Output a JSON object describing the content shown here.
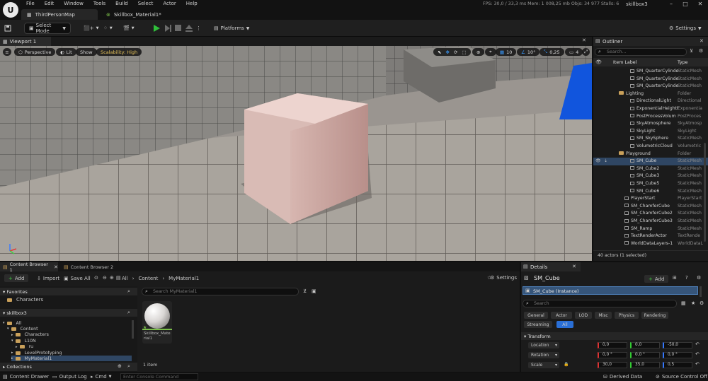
{
  "titlebar": {
    "logo": "U",
    "menu": [
      "File",
      "Edit",
      "Window",
      "Tools",
      "Build",
      "Select",
      "Actor",
      "Help"
    ],
    "tabs": [
      {
        "label": "ThirdPersonMap"
      },
      {
        "label": "Skillbox_Material1*"
      }
    ],
    "stats": "FPS: 30,0 / 33,3 ms  Mem: 1 008,25 mb  Objs: 34 977  Stalls: 6",
    "project": "skillbox3",
    "colors": {
      "bg": "#121212",
      "accent": "#0070e0"
    }
  },
  "toolbar": {
    "select_mode": "Select Mode",
    "platforms": "Platforms",
    "settings": "Settings"
  },
  "viewport": {
    "tab_label": "Viewport 1",
    "perspective": "Perspective",
    "lit": "Lit",
    "show": "Show",
    "scalability": "Scalability: High",
    "grid_snap": "10",
    "rot_snap": "10°",
    "scale_snap": "0,25",
    "cam_speed": "4"
  },
  "outliner": {
    "title": "Outliner",
    "search_placeholder": "Search...",
    "col_label": "Item Label",
    "col_type": "Type",
    "rows": [
      {
        "label": "SM_QuarterCylinde",
        "type": "StaticMesh",
        "indent": 2,
        "kind": "mesh"
      },
      {
        "label": "SM_QuarterCylinde",
        "type": "StaticMesh",
        "indent": 2,
        "kind": "mesh"
      },
      {
        "label": "SM_QuarterCylinde",
        "type": "StaticMesh",
        "indent": 2,
        "kind": "mesh"
      },
      {
        "label": "Lighting",
        "type": "Folder",
        "indent": 1,
        "kind": "folder"
      },
      {
        "label": "DirectionalLight",
        "type": "Directional",
        "indent": 2,
        "kind": "mesh"
      },
      {
        "label": "ExponentialHeightF",
        "type": "Exponentia",
        "indent": 2,
        "kind": "mesh"
      },
      {
        "label": "PostProcessVolum",
        "type": "PostProces",
        "indent": 2,
        "kind": "mesh"
      },
      {
        "label": "SkyAtmosphere",
        "type": "SkyAtmosp",
        "indent": 2,
        "kind": "mesh"
      },
      {
        "label": "SkyLight",
        "type": "SkyLight",
        "indent": 2,
        "kind": "mesh"
      },
      {
        "label": "SM_SkySphere",
        "type": "StaticMesh",
        "indent": 2,
        "kind": "mesh"
      },
      {
        "label": "VolumetricCloud",
        "type": "Volumetric",
        "indent": 2,
        "kind": "mesh"
      },
      {
        "label": "Playground",
        "type": "Folder",
        "indent": 1,
        "kind": "folder"
      },
      {
        "label": "SM_Cube",
        "type": "StaticMesh",
        "indent": 2,
        "kind": "mesh",
        "selected": true
      },
      {
        "label": "SM_Cube2",
        "type": "StaticMesh",
        "indent": 2,
        "kind": "mesh"
      },
      {
        "label": "SM_Cube3",
        "type": "StaticMesh",
        "indent": 2,
        "kind": "mesh"
      },
      {
        "label": "SM_Cube5",
        "type": "StaticMesh",
        "indent": 2,
        "kind": "mesh"
      },
      {
        "label": "SM_Cube6",
        "type": "StaticMesh",
        "indent": 2,
        "kind": "mesh"
      },
      {
        "label": "PlayerStart",
        "type": "PlayerStart",
        "indent": 1,
        "kind": "mesh"
      },
      {
        "label": "SM_ChamferCube",
        "type": "StaticMesh",
        "indent": 1,
        "kind": "mesh"
      },
      {
        "label": "SM_ChamferCube2",
        "type": "StaticMesh",
        "indent": 1,
        "kind": "mesh"
      },
      {
        "label": "SM_ChamferCube3",
        "type": "StaticMesh",
        "indent": 1,
        "kind": "mesh"
      },
      {
        "label": "SM_Ramp",
        "type": "StaticMesh",
        "indent": 1,
        "kind": "mesh"
      },
      {
        "label": "TextRenderActor",
        "type": "TextRende",
        "indent": 1,
        "kind": "mesh"
      },
      {
        "label": "WorldDataLayers-1",
        "type": "WorldDataL",
        "indent": 1,
        "kind": "mesh"
      }
    ],
    "footer": "40 actors (1 selected)"
  },
  "content_browser": {
    "tabs": [
      "Content Browser 1",
      "Content Browser 2"
    ],
    "add": "Add",
    "import": "Import",
    "save_all": "Save All",
    "breadcrumb": [
      "All",
      "Content",
      "MyMaterial1"
    ],
    "settings": "Settings",
    "favorites": "Favorites",
    "favorites_items": [
      "Characters"
    ],
    "project": "skillbox3",
    "tree": [
      {
        "label": "All",
        "indent": 0
      },
      {
        "label": "Content",
        "indent": 1
      },
      {
        "label": "Characters",
        "indent": 2
      },
      {
        "label": "L10N",
        "indent": 2
      },
      {
        "label": "ru",
        "indent": 3
      },
      {
        "label": "LevelPrototyping",
        "indent": 2
      },
      {
        "label": "MyMaterial1",
        "indent": 2,
        "selected": true
      }
    ],
    "collections": "Collections",
    "search_placeholder": "Search MyMaterial1",
    "asset_name": "Skillbox_Material1",
    "item_count": "1 item"
  },
  "details": {
    "title": "Details",
    "object": "SM_Cube",
    "add": "Add",
    "instance": "SM_Cube (Instance)",
    "search_placeholder": "Search",
    "filters": [
      "General",
      "Actor",
      "LOD",
      "Misc",
      "Physics",
      "Rendering"
    ],
    "filters2": [
      "Streaming",
      "All"
    ],
    "transform": "Transform",
    "props": [
      {
        "label": "Location",
        "x": "0,0",
        "y": "0,0",
        "z": "-50,0"
      },
      {
        "label": "Rotation",
        "x": "0,0 °",
        "y": "0,0 °",
        "z": "0,0 °"
      },
      {
        "label": "Scale",
        "x": "30,0",
        "y": "35,0",
        "z": "0,5"
      }
    ]
  },
  "bottombar": {
    "content_drawer": "Content Drawer",
    "output_log": "Output Log",
    "cmd": "Cmd",
    "console_placeholder": "Enter Console Command",
    "derived_data": "Derived Data",
    "source_control": "Source Control Off"
  }
}
